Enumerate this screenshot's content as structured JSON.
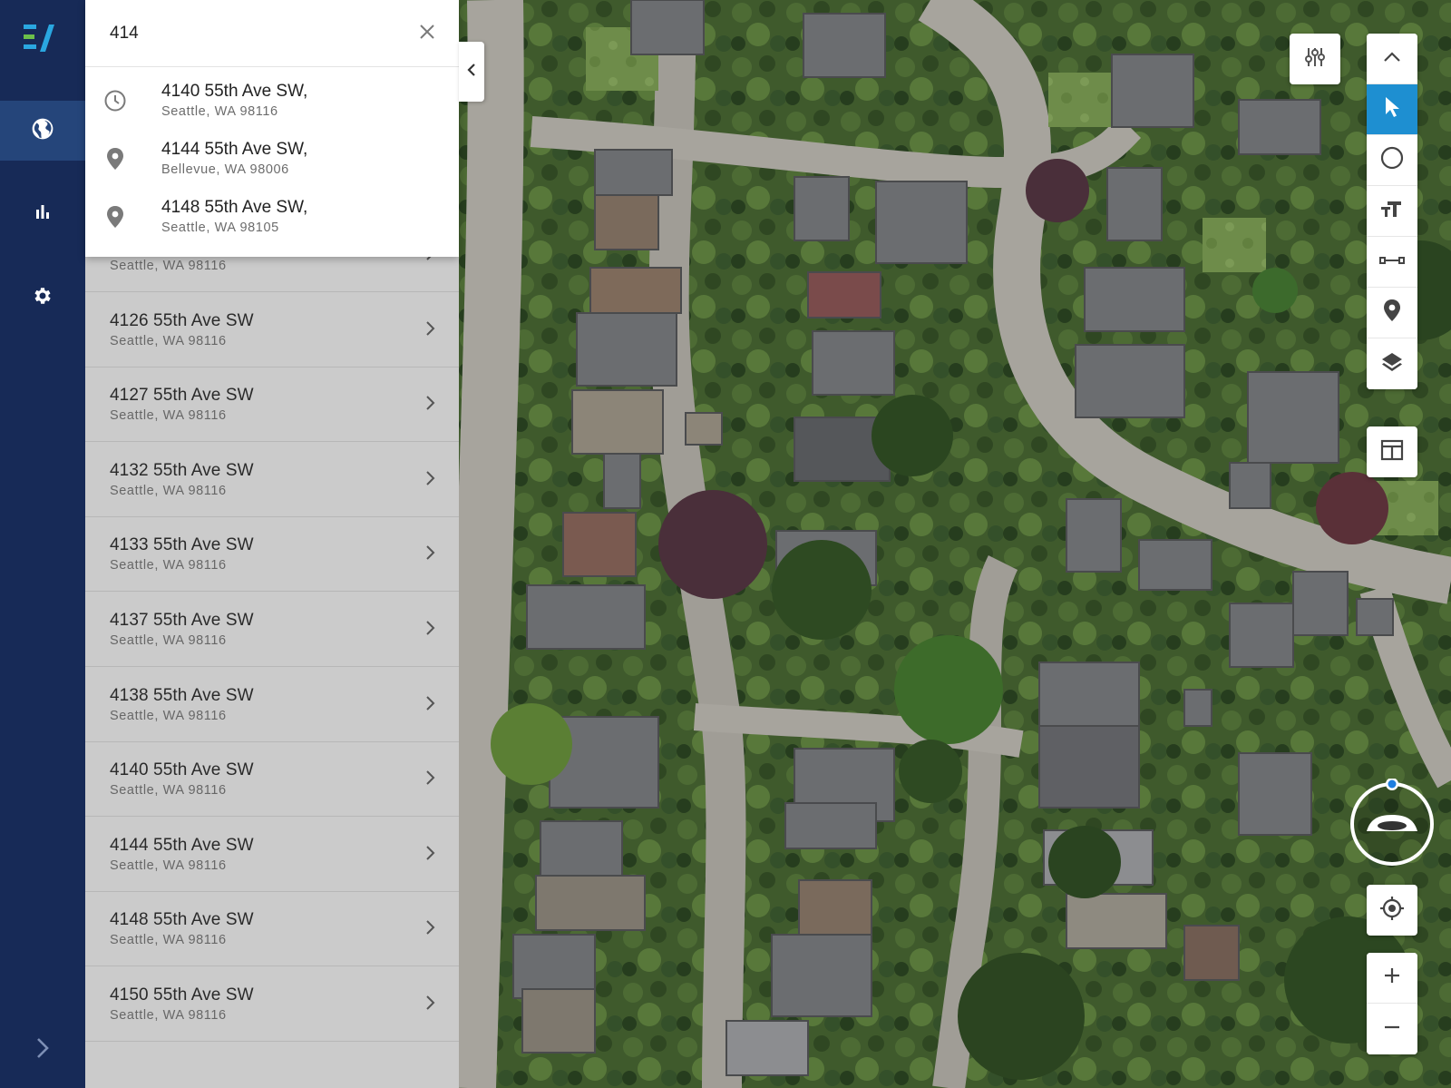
{
  "search": {
    "value": "414",
    "placeholder": ""
  },
  "suggestions": [
    {
      "icon": "history-icon",
      "address": "4140 55th Ave SW,",
      "city": "Seattle, WA 98116"
    },
    {
      "icon": "location-pin-icon",
      "address": "4144 55th Ave SW,",
      "city": "Bellevue, WA 98006"
    },
    {
      "icon": "location-pin-icon",
      "address": "4148 55th Ave SW,",
      "city": "Seattle, WA 98105"
    }
  ],
  "results": [
    {
      "address": "",
      "city": "Seattle, WA 98116"
    },
    {
      "address": "4126 55th Ave SW",
      "city": "Seattle, WA 98116"
    },
    {
      "address": "4127 55th Ave SW",
      "city": "Seattle, WA 98116"
    },
    {
      "address": "4132 55th Ave SW",
      "city": "Seattle, WA 98116"
    },
    {
      "address": "4133 55th Ave SW",
      "city": "Seattle, WA 98116"
    },
    {
      "address": "4137 55th Ave SW",
      "city": "Seattle, WA 98116"
    },
    {
      "address": "4138 55th Ave SW",
      "city": "Seattle, WA 98116"
    },
    {
      "address": "4140 55th Ave SW",
      "city": "Seattle, WA 98116"
    },
    {
      "address": "4144 55th Ave SW",
      "city": "Seattle, WA 98116"
    },
    {
      "address": "4148 55th Ave SW",
      "city": "Seattle, WA 98116"
    },
    {
      "address": "4150 55th Ave SW",
      "city": "Seattle, WA 98116"
    }
  ],
  "nav": {
    "items": [
      "globe-icon",
      "bar-chart-icon",
      "gear-icon"
    ],
    "active": "globe-icon",
    "expand": "chevron-right-icon"
  },
  "tools": {
    "filter": "sliders-icon",
    "group": [
      "chevron-up-icon",
      "pointer-icon",
      "circle-icon",
      "text-size-icon",
      "measure-icon",
      "location-pin-icon",
      "layers-icon"
    ],
    "active": "pointer-icon",
    "split_view": "split-view-icon",
    "compass": "compass-icon",
    "locate": "crosshair-icon",
    "zoom_in": "plus-icon",
    "zoom_out": "minus-icon"
  },
  "colors": {
    "rail": "#172a57",
    "rail_active": "#25457a",
    "accent": "#1e8fd1",
    "logo_blue": "#2aa7e0",
    "logo_green": "#6cc04a"
  }
}
